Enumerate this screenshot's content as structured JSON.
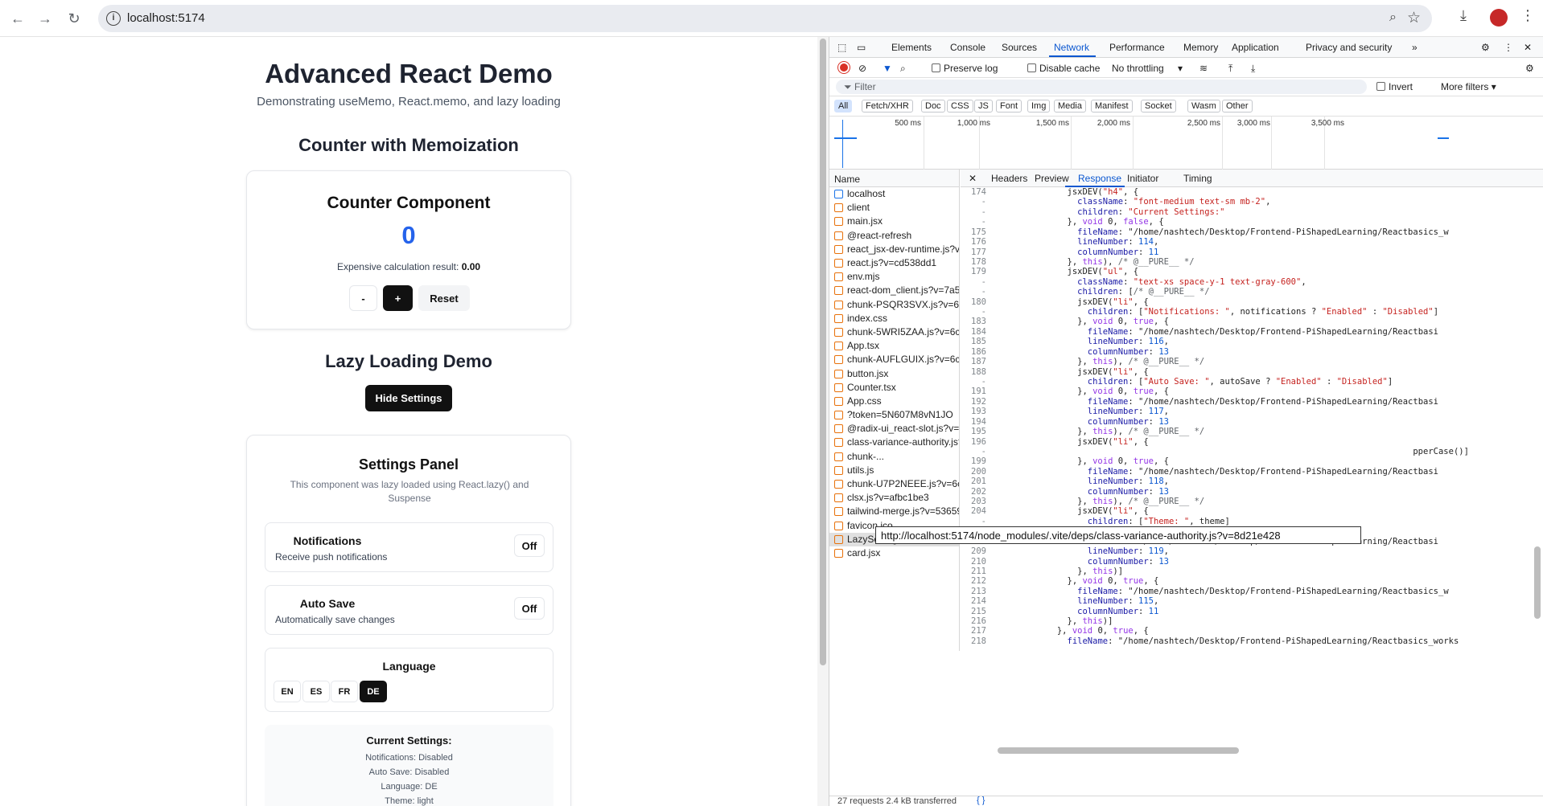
{
  "browser": {
    "url": "localhost:5174",
    "back_icon": "←",
    "forward_icon": "→",
    "reload_icon": "↻",
    "zoom_icon": "⌕",
    "star_icon": "☆",
    "download_icon": "⤓",
    "menu_icon": "⋮"
  },
  "page": {
    "title": "Advanced React Demo",
    "subtitle": "Demonstrating useMemo, React.memo, and lazy loading",
    "counter_section": "Counter with Memoization",
    "counter_card": {
      "title": "Counter Component",
      "value": "0",
      "expensive_label": "Expensive calculation result:",
      "expensive_value": "0.00",
      "dec_label": "-",
      "inc_label": "+",
      "reset_label": "Reset"
    },
    "lazy_section": "Lazy Loading Demo",
    "hide_settings_label": "Hide Settings",
    "settings": {
      "title": "Settings Panel",
      "description": "This component was lazy loaded using React.lazy() and Suspense",
      "notifications_label": "Notifications",
      "notifications_desc": "Receive push notifications",
      "notifications_toggle": "Off",
      "autosave_label": "Auto Save",
      "autosave_desc": "Automatically save changes",
      "autosave_toggle": "Off",
      "language_label": "Language",
      "languages": [
        "EN",
        "ES",
        "FR",
        "DE"
      ],
      "selected_language": "DE",
      "current_title": "Current Settings:",
      "current_lines": [
        "Notifications: Disabled",
        "Auto Save: Disabled",
        "Language: DE",
        "Theme: light"
      ]
    }
  },
  "devtools": {
    "tabs": [
      "Elements",
      "Console",
      "Sources",
      "Network",
      "Performance",
      "Memory",
      "Application",
      "Privacy and security"
    ],
    "active_tab": "Network",
    "more_tabs_icon": "»",
    "preserve_log": "Preserve log",
    "disable_cache": "Disable cache",
    "throttling": "No throttling",
    "filter_placeholder": "Filter",
    "invert": "Invert",
    "more_filters": "More filters",
    "types": [
      "All",
      "Fetch/XHR",
      "Doc",
      "CSS",
      "JS",
      "Font",
      "Img",
      "Media",
      "Manifest",
      "Socket",
      "Wasm",
      "Other"
    ],
    "timeline_labels": [
      "500 ms",
      "1,000 ms",
      "1,500 ms",
      "2,000 ms",
      "2,500 ms",
      "3,000 ms",
      "3,500 ms"
    ],
    "name_header": "Name",
    "requests": [
      "localhost",
      "client",
      "main.jsx",
      "@react-refresh",
      "react_jsx-dev-runtime.js?v=c...",
      "react.js?v=cd538dd1",
      "env.mjs",
      "react-dom_client.js?v=7a5e5...",
      "chunk-PSQR3SVX.js?v=6c63a...",
      "index.css",
      "chunk-5WRI5ZAA.js?v=6c63a...",
      "App.tsx",
      "chunk-AUFLGUIX.js?v=6c63a2...",
      "button.jsx",
      "Counter.tsx",
      "App.css",
      "?token=5N607M8vN1JO",
      "@radix-ui_react-slot.js?v=b0e...",
      "class-variance-authority.js?v=...",
      "chunk-...",
      "utils.js",
      "chunk-U7P2NEEE.js?v=6c63a...",
      "clsx.js?v=afbc1be3",
      "tailwind-merge.js?v=53659204",
      "favicon.ico",
      "LazySettings.tsx",
      "card.jsx"
    ],
    "selected_request": "LazySettings.tsx",
    "response_tabs": [
      "Headers",
      "Preview",
      "Response",
      "Initiator",
      "Timing"
    ],
    "active_response_tab": "Response",
    "tooltip": "http://localhost:5174/node_modules/.vite/deps/class-variance-authority.js?v=8d21e428",
    "code_lines": [
      {
        "n": "174",
        "t": "              jsxDEV(\"h4\", {"
      },
      {
        "n": "-",
        "t": "                className: \"font-medium text-sm mb-2\","
      },
      {
        "n": "-",
        "t": "                children: \"Current Settings:\""
      },
      {
        "n": "-",
        "t": "              }, void 0, false, {"
      },
      {
        "n": "175",
        "t": "                fileName: \"/home/nashtech/Desktop/Frontend-PiShapedLearning/Reactbasics_w"
      },
      {
        "n": "176",
        "t": "                lineNumber: 114,"
      },
      {
        "n": "177",
        "t": "                columnNumber: 11"
      },
      {
        "n": "178",
        "t": "              }, this), /* @__PURE__ */"
      },
      {
        "n": "179",
        "t": "              jsxDEV(\"ul\", {"
      },
      {
        "n": "-",
        "t": "                className: \"text-xs space-y-1 text-gray-600\","
      },
      {
        "n": "-",
        "t": "                children: [/* @__PURE__ */"
      },
      {
        "n": "180",
        "t": "                jsxDEV(\"li\", {"
      },
      {
        "n": "-",
        "t": "                  children: [\"Notifications: \", notifications ? \"Enabled\" : \"Disabled\"]"
      },
      {
        "n": "183",
        "t": "                }, void 0, true, {"
      },
      {
        "n": "184",
        "t": "                  fileName: \"/home/nashtech/Desktop/Frontend-PiShapedLearning/Reactbasi"
      },
      {
        "n": "185",
        "t": "                  lineNumber: 116,"
      },
      {
        "n": "186",
        "t": "                  columnNumber: 13"
      },
      {
        "n": "187",
        "t": "                }, this), /* @__PURE__ */"
      },
      {
        "n": "188",
        "t": "                jsxDEV(\"li\", {"
      },
      {
        "n": "-",
        "t": "                  children: [\"Auto Save: \", autoSave ? \"Enabled\" : \"Disabled\"]"
      },
      {
        "n": "191",
        "t": "                }, void 0, true, {"
      },
      {
        "n": "192",
        "t": "                  fileName: \"/home/nashtech/Desktop/Frontend-PiShapedLearning/Reactbasi"
      },
      {
        "n": "193",
        "t": "                  lineNumber: 117,"
      },
      {
        "n": "194",
        "t": "                  columnNumber: 13"
      },
      {
        "n": "195",
        "t": "                }, this), /* @__PURE__ */"
      },
      {
        "n": "196",
        "t": "                jsxDEV(\"li\", {"
      },
      {
        "n": "-",
        "t": "                                                                                  pperCase()]"
      },
      {
        "n": "199",
        "t": "                }, void 0, true, {"
      },
      {
        "n": "200",
        "t": "                  fileName: \"/home/nashtech/Desktop/Frontend-PiShapedLearning/Reactbasi"
      },
      {
        "n": "201",
        "t": "                  lineNumber: 118,"
      },
      {
        "n": "202",
        "t": "                  columnNumber: 13"
      },
      {
        "n": "203",
        "t": "                }, this), /* @__PURE__ */"
      },
      {
        "n": "204",
        "t": "                jsxDEV(\"li\", {"
      },
      {
        "n": "-",
        "t": "                  children: [\"Theme: \", theme]"
      },
      {
        "n": "207",
        "t": "                }, void 0, true, {"
      },
      {
        "n": "208",
        "t": "                  fileName: \"/home/nashtech/Desktop/Frontend-PiShapedLearning/Reactbasi"
      },
      {
        "n": "209",
        "t": "                  lineNumber: 119,"
      },
      {
        "n": "210",
        "t": "                  columnNumber: 13"
      },
      {
        "n": "211",
        "t": "                }, this)]"
      },
      {
        "n": "212",
        "t": "              }, void 0, true, {"
      },
      {
        "n": "213",
        "t": "                fileName: \"/home/nashtech/Desktop/Frontend-PiShapedLearning/Reactbasics_w"
      },
      {
        "n": "214",
        "t": "                lineNumber: 115,"
      },
      {
        "n": "215",
        "t": "                columnNumber: 11"
      },
      {
        "n": "216",
        "t": "              }, this)]"
      },
      {
        "n": "217",
        "t": "            }, void 0, true, {"
      },
      {
        "n": "218",
        "t": "              fileName: \"/home/nashtech/Desktop/Frontend-PiShapedLearning/Reactbasics_works"
      }
    ],
    "status": "27 requests   2.4 kB transferred",
    "format_icon": "{ }"
  }
}
